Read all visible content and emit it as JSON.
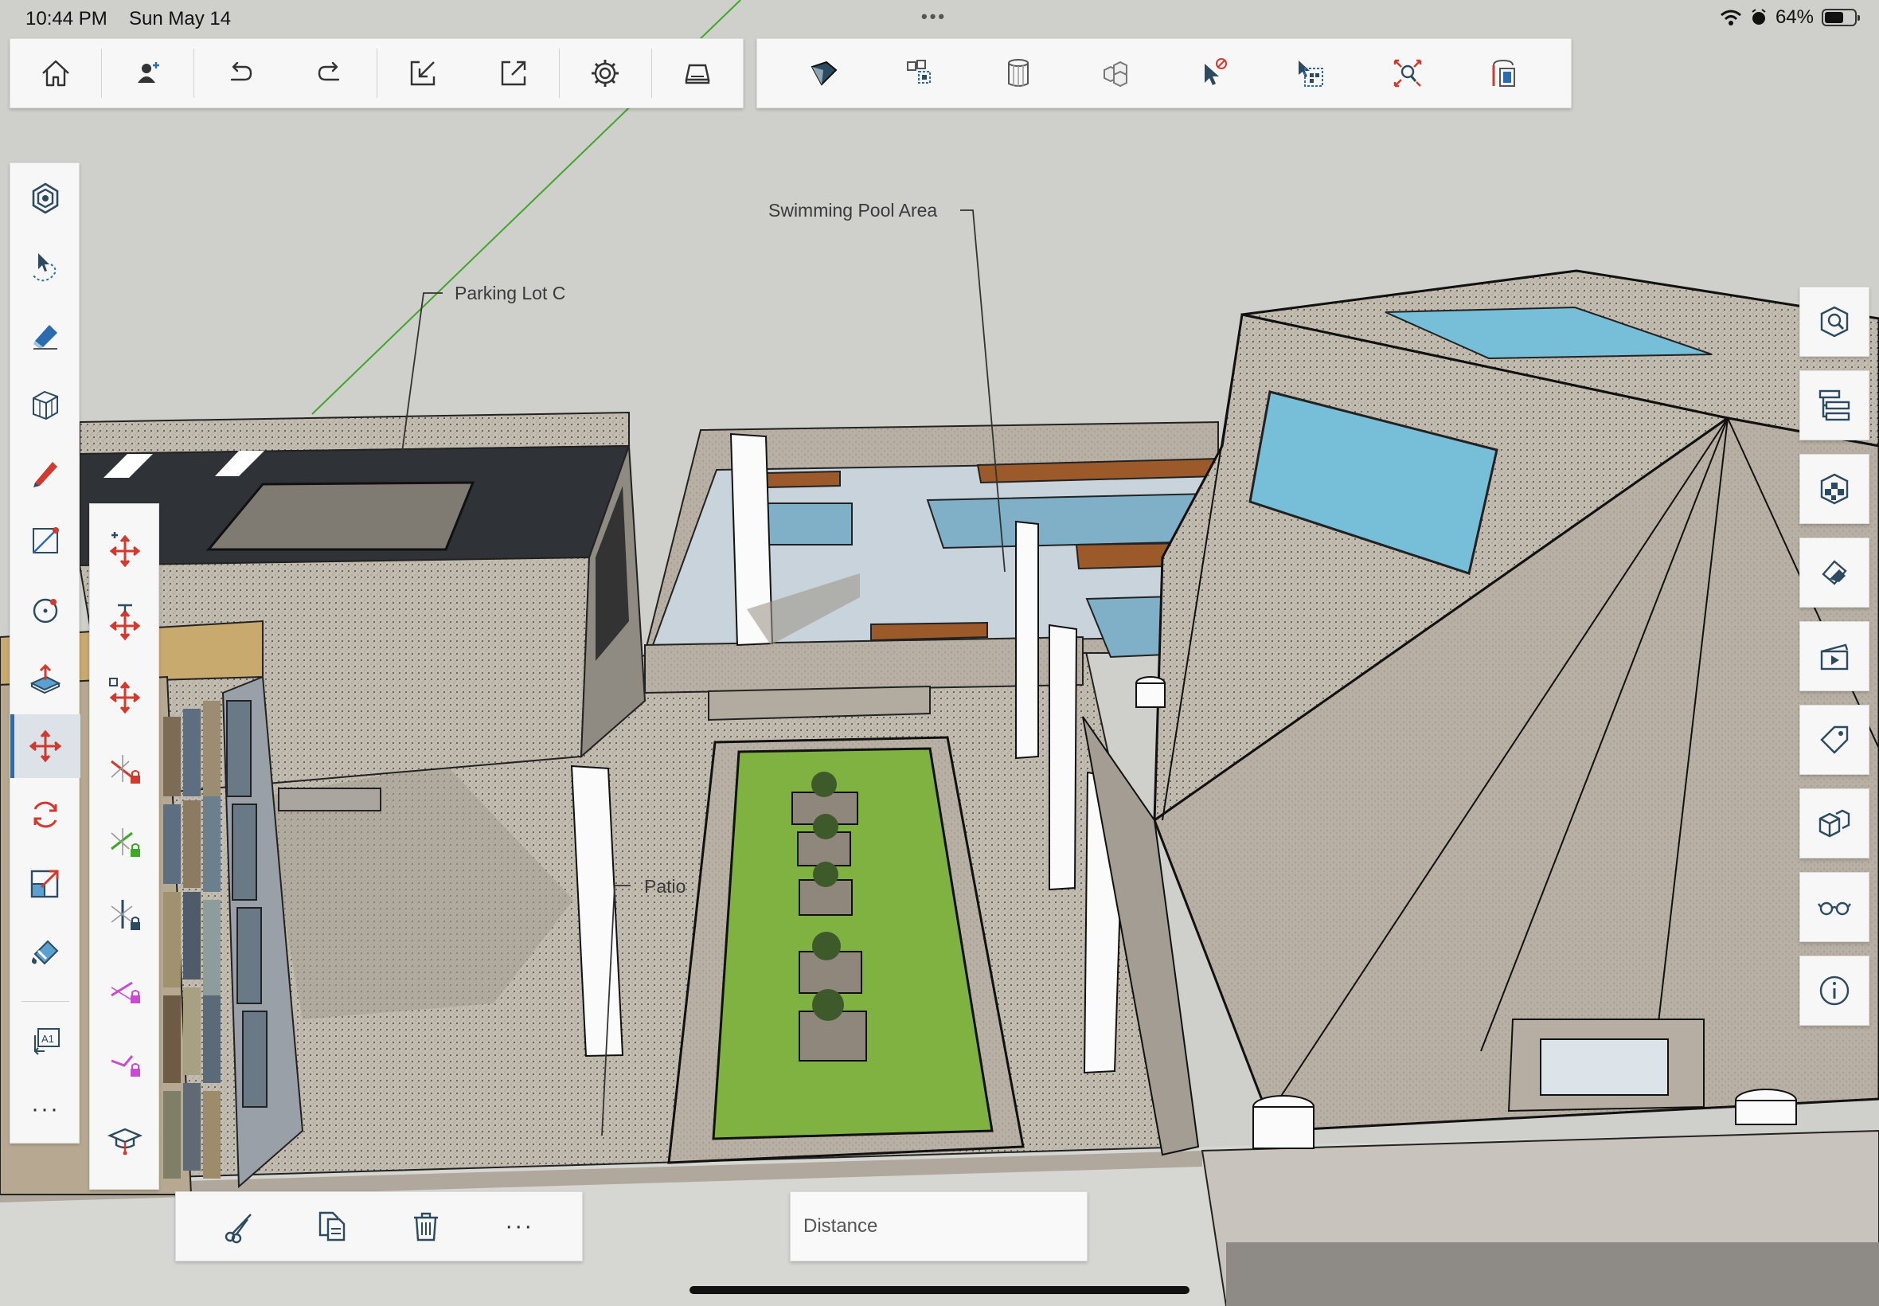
{
  "status_bar": {
    "time": "10:44 PM",
    "date": "Sun May 14",
    "multitask_dots": "•••",
    "battery_text": "64%",
    "battery_level": 0.64,
    "icons": [
      "wifi-icon",
      "alarm-icon",
      "battery-icon"
    ]
  },
  "top_toolbar_left": {
    "buttons": [
      "home-icon",
      "add-user-icon",
      "undo-icon",
      "redo-icon",
      "import-icon",
      "export-icon",
      "settings-icon",
      "tray-icon"
    ]
  },
  "top_toolbar_right": {
    "buttons": [
      "display-style-icon",
      "components-icon",
      "cylinder-icon",
      "groups-icon",
      "no-select-icon",
      "select-component-icon",
      "zoom-extents-icon",
      "tools-tray-icon"
    ]
  },
  "left_toolbar": {
    "tools": [
      "orbit-icon",
      "lasso-select-icon",
      "eraser-icon",
      "box-select-icon",
      "pencil-icon",
      "line-icon",
      "circle-icon",
      "push-pull-icon",
      "move-icon",
      "rotate-icon",
      "scale-icon",
      "paint-icon",
      "text-icon"
    ],
    "active_tool": "move-icon",
    "more_label": "···"
  },
  "move_sub_toolbar": {
    "tools": [
      "move-add-icon",
      "move-up-icon",
      "move-copy-icon",
      "lock-red-axis-icon",
      "lock-green-axis-icon",
      "lock-blue-axis-icon",
      "lock-magenta-1-icon",
      "lock-magenta-2-icon",
      "tutorial-icon"
    ]
  },
  "right_toolbar": {
    "buttons": [
      "views-icon",
      "outliner-icon",
      "materials-icon",
      "eraser-panel-icon",
      "scenes-icon",
      "tags-icon",
      "components-panel-icon",
      "glasses-icon",
      "info-icon"
    ]
  },
  "bottom_actions": {
    "buttons": [
      "cut-icon",
      "copy-icon",
      "delete-icon"
    ],
    "more_label": "···"
  },
  "vcb": {
    "placeholder": "Distance"
  },
  "scene": {
    "labels": {
      "parking": "Parking Lot C",
      "pool": "Swimming Pool Area",
      "patio": "Patio"
    },
    "colors": {
      "sky": "#cfd0cb",
      "roof": "#bfb7ad",
      "asphalt": "#2f3236",
      "grass": "#7fb241",
      "glass": "#77bfd8",
      "wood": "#9c5a2b",
      "green_axis": "#3fa62a",
      "accent": "#2b6cb0"
    }
  }
}
